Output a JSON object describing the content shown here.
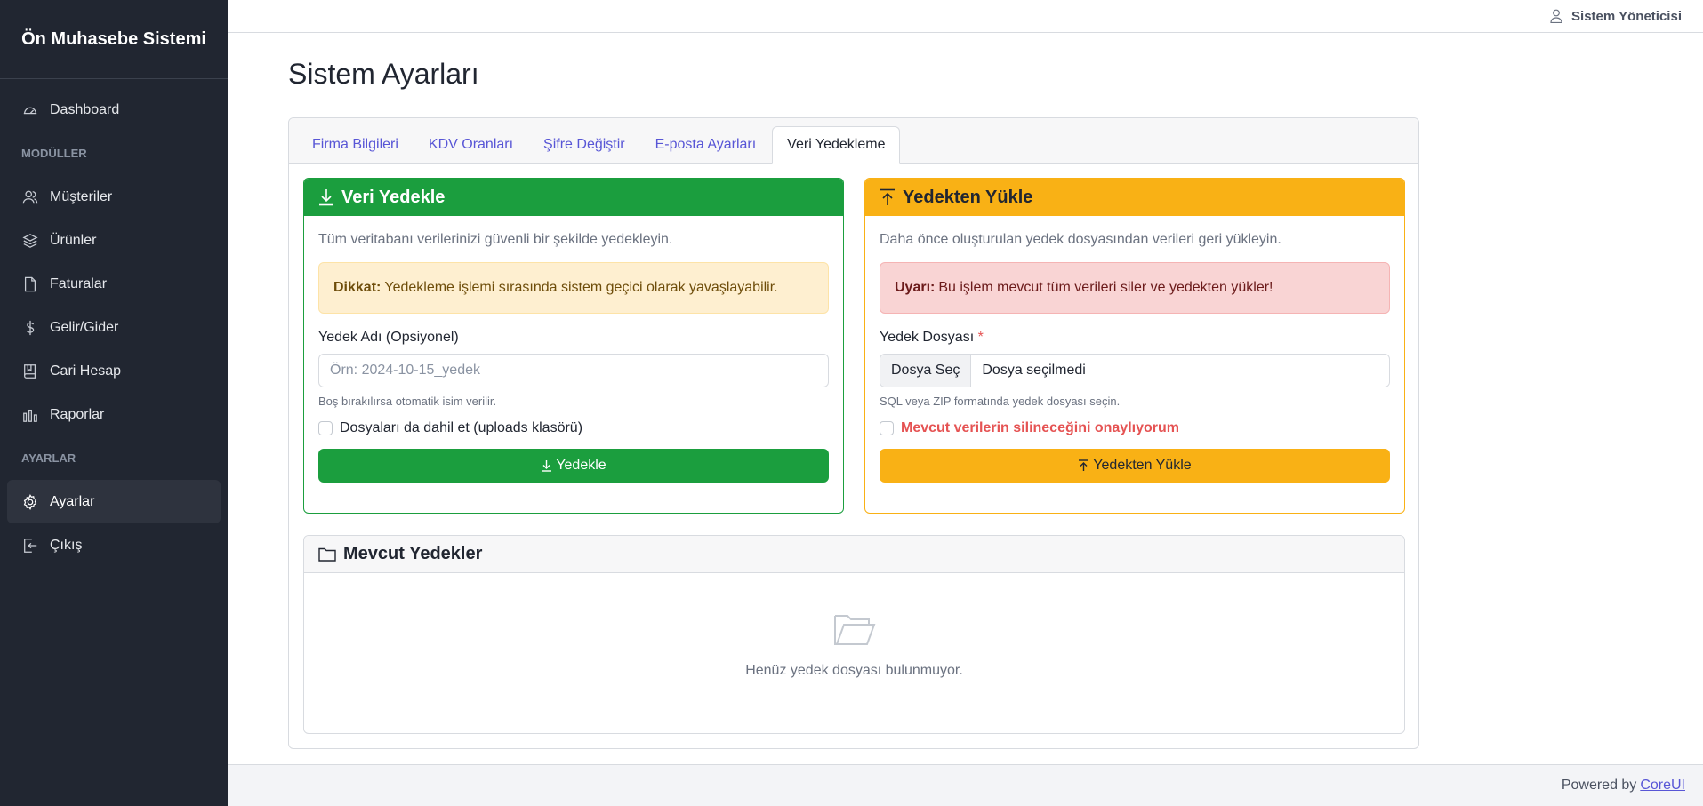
{
  "sidebar": {
    "brand": "Ön Muhasebe Sistemi",
    "dashboard": "Dashboard",
    "modules_title": "MODÜLLER",
    "items": [
      {
        "label": "Müşteriler",
        "icon": "users-icon"
      },
      {
        "label": "Ürünler",
        "icon": "layers-icon"
      },
      {
        "label": "Faturalar",
        "icon": "file-icon"
      },
      {
        "label": "Gelir/Gider",
        "icon": "dollar-icon"
      },
      {
        "label": "Cari Hesap",
        "icon": "book-icon"
      },
      {
        "label": "Raporlar",
        "icon": "chart-icon"
      }
    ],
    "settings_title": "AYARLAR",
    "settings": "Ayarlar",
    "logout": "Çıkış"
  },
  "header": {
    "user": "Sistem Yöneticisi"
  },
  "page": {
    "title": "Sistem Ayarları"
  },
  "tabs": [
    "Firma Bilgileri",
    "KDV Oranları",
    "Şifre Değiştir",
    "E-posta Ayarları",
    "Veri Yedekleme"
  ],
  "backup": {
    "title": "Veri Yedekle",
    "description": "Tüm veritabanı verilerinizi güvenli bir şekilde yedekleyin.",
    "alert_bold": "Dikkat:",
    "alert_text": "Yedekleme işlemi sırasında sistem geçici olarak yavaşlayabilir.",
    "name_label": "Yedek Adı (Opsiyonel)",
    "name_placeholder": "Örn: 2024-10-15_yedek",
    "name_help": "Boş bırakılırsa otomatik isim verilir.",
    "include_files": "Dosyaları da dahil et (uploads klasörü)",
    "button": "Yedekle"
  },
  "restore": {
    "title": "Yedekten Yükle",
    "description": "Daha önce oluşturulan yedek dosyasından verileri geri yükleyin.",
    "alert_bold": "Uyarı:",
    "alert_text": "Bu işlem mevcut tüm verileri siler ve yedekten yükler!",
    "file_label": "Yedek Dosyası",
    "required_mark": "*",
    "file_button": "Dosya Seç",
    "file_text": "Dosya seçilmedi",
    "file_help": "SQL veya ZIP formatında yedek dosyası seçin.",
    "confirm": "Mevcut verilerin silineceğini onaylıyorum",
    "button": "Yedekten Yükle"
  },
  "backups": {
    "title": "Mevcut Yedekler",
    "empty": "Henüz yedek dosyası bulunmuyor."
  },
  "footer": {
    "powered": "Powered by",
    "link": "CoreUI"
  },
  "colors": {
    "sidebar_bg": "#212631",
    "success": "#1b9e3e",
    "warning": "#f9b115",
    "danger": "#e55353",
    "link": "#5856d6"
  }
}
